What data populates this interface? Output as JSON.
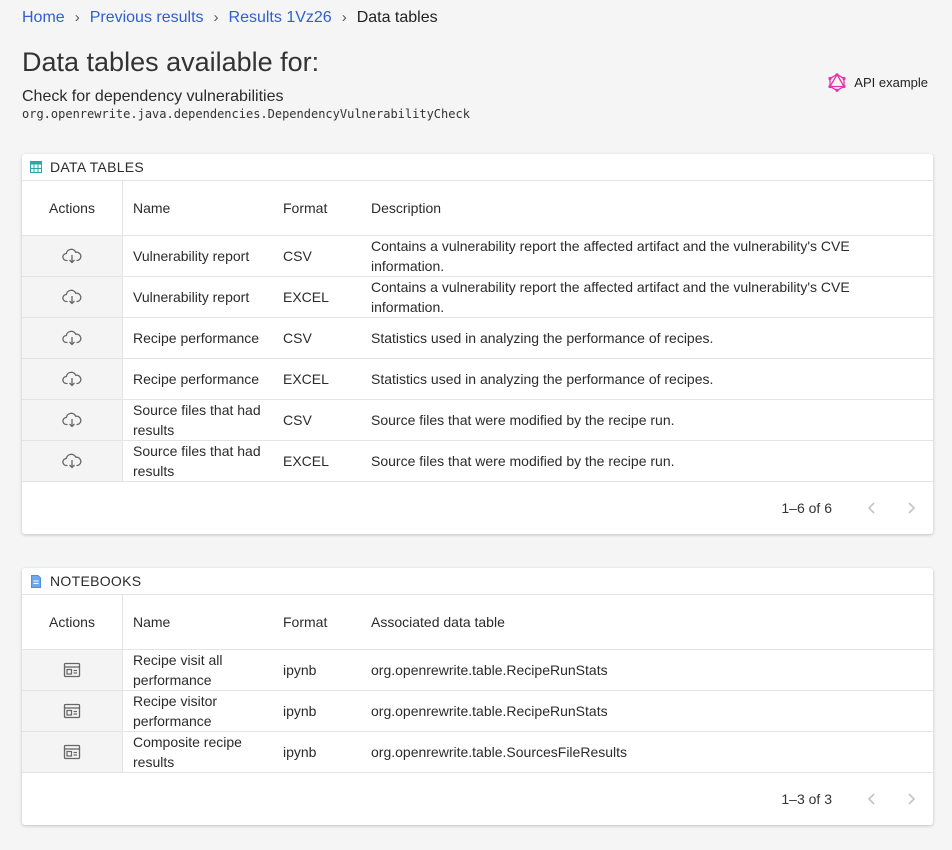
{
  "breadcrumb": {
    "home": "Home",
    "previous": "Previous results",
    "results": "Results 1Vz26",
    "current": "Data tables",
    "separator": "›"
  },
  "header": {
    "title": "Data tables available for:",
    "recipe_name": "Check for dependency vulnerabilities",
    "recipe_id": "org.openrewrite.java.dependencies.DependencyVulnerabilityCheck",
    "api_example": "API example"
  },
  "data_tables": {
    "section_title": "DATA TABLES",
    "columns": {
      "actions": "Actions",
      "name": "Name",
      "format": "Format",
      "description": "Description"
    },
    "rows": [
      {
        "name": "Vulnerability report",
        "format": "CSV",
        "description": "Contains a vulnerability report the affected artifact and the vulnerability's CVE information."
      },
      {
        "name": "Vulnerability report",
        "format": "EXCEL",
        "description": "Contains a vulnerability report the affected artifact and the vulnerability's CVE information."
      },
      {
        "name": "Recipe performance",
        "format": "CSV",
        "description": "Statistics used in analyzing the performance of recipes."
      },
      {
        "name": "Recipe performance",
        "format": "EXCEL",
        "description": "Statistics used in analyzing the performance of recipes."
      },
      {
        "name": "Source files that had results",
        "format": "CSV",
        "description": "Source files that were modified by the recipe run."
      },
      {
        "name": "Source files that had results",
        "format": "EXCEL",
        "description": "Source files that were modified by the recipe run."
      }
    ],
    "pagination": "1–6 of 6"
  },
  "notebooks": {
    "section_title": "NOTEBOOKS",
    "columns": {
      "actions": "Actions",
      "name": "Name",
      "format": "Format",
      "associated": "Associated data table"
    },
    "rows": [
      {
        "name": "Recipe visit all performance",
        "format": "ipynb",
        "associated": "org.openrewrite.table.RecipeRunStats"
      },
      {
        "name": "Recipe visitor performance",
        "format": "ipynb",
        "associated": "org.openrewrite.table.RecipeRunStats"
      },
      {
        "name": "Composite recipe results",
        "format": "ipynb",
        "associated": "org.openrewrite.table.SourcesFileResults"
      }
    ],
    "pagination": "1–3 of 3"
  },
  "colors": {
    "link": "#2f5fd0",
    "graphql_accent": "#e535ab",
    "table_icon": "#2aa6a6",
    "notebook_icon": "#4a90e2"
  },
  "icons": {
    "api": "graphql-icon",
    "data_tables": "table-icon",
    "notebooks": "notebook-icon",
    "download": "cloud-download-icon",
    "open_notebook": "notebook-view-icon",
    "prev": "chevron-left-icon",
    "next": "chevron-right-icon"
  }
}
